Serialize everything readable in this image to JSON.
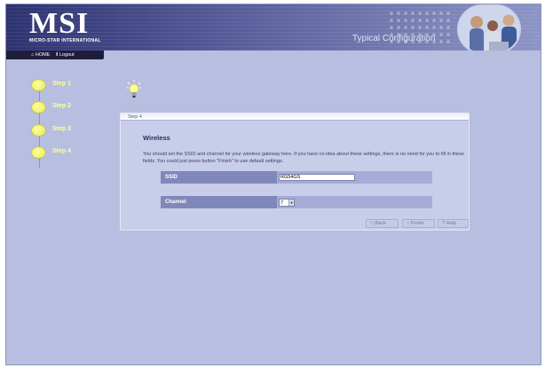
{
  "header": {
    "logo": "MSI",
    "logo_subtitle": "MICRO-STAR INTERNATIONAL",
    "page_heading": "Typical Configuration"
  },
  "nav": {
    "home_label": "HOME",
    "logout_label": "Logout"
  },
  "steps": [
    {
      "label": "Step 1"
    },
    {
      "label": "Step 2"
    },
    {
      "label": "Step 3"
    },
    {
      "label": "Step 4"
    }
  ],
  "panel": {
    "header_label": "Step 4",
    "section_title": "Wireless",
    "description": "You should set the SSID and channel for your wireless gateway here. If you have no idea about these settings, there is no need for you to fill in these fields. You could just press button \"Finish\" to use default settings.",
    "fields": {
      "ssid_label": "SSID",
      "ssid_value": "RG54GS",
      "channel_label": "Channel",
      "channel_value": "7"
    },
    "buttons": {
      "back": "Back",
      "finish": "Finish",
      "help": "Help"
    }
  },
  "colors": {
    "background": "#b7bee0",
    "banner": "#3a3f80",
    "step_circle": "#ffff8c",
    "field_label_bg": "#8088bb"
  },
  "icons": [
    "home-icon",
    "logout-icon",
    "lightbulb-icon",
    "back-arrow-icon",
    "finish-icon",
    "help-icon"
  ]
}
